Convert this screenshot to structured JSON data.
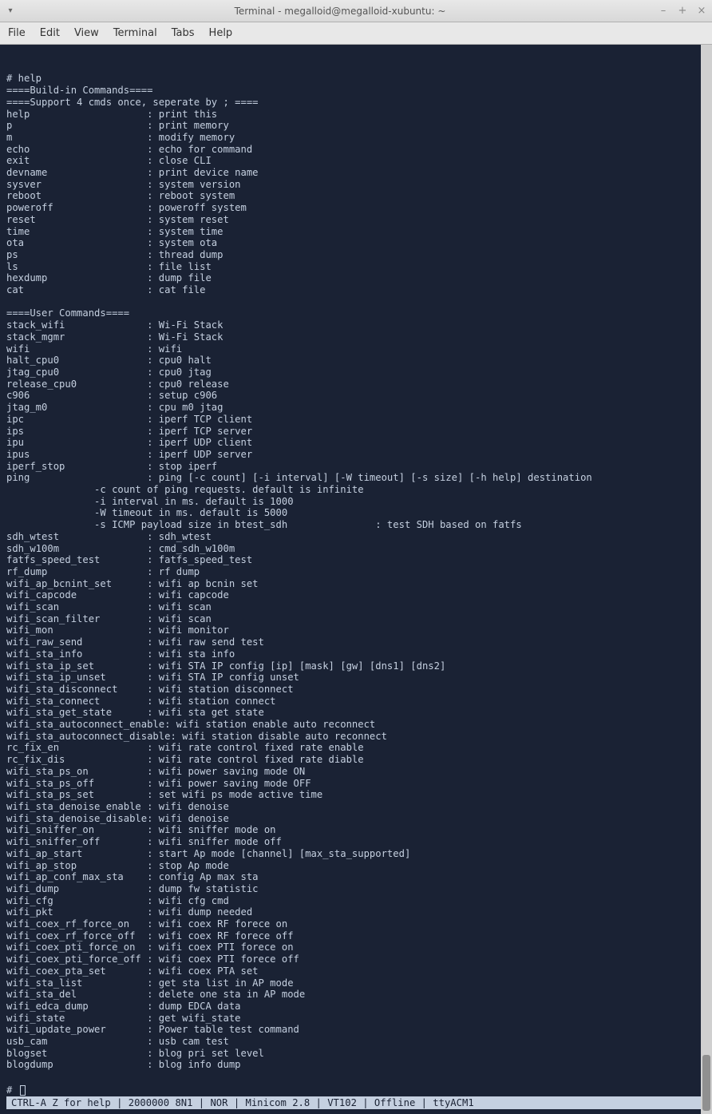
{
  "window": {
    "title": "Terminal - megalloid@megalloid-xubuntu: ~"
  },
  "menu": {
    "items": [
      "File",
      "Edit",
      "View",
      "Terminal",
      "Tabs",
      "Help"
    ]
  },
  "terminal": {
    "prompt1": "# help",
    "section_builtin": "====Build-in Commands====",
    "section_support": "====Support 4 cmds once, seperate by ; ====",
    "builtin_cmds": [
      {
        "cmd": "help",
        "desc": "print this"
      },
      {
        "cmd": "p",
        "desc": "print memory"
      },
      {
        "cmd": "m",
        "desc": "modify memory"
      },
      {
        "cmd": "echo",
        "desc": "echo for command"
      },
      {
        "cmd": "exit",
        "desc": "close CLI"
      },
      {
        "cmd": "devname",
        "desc": "print device name"
      },
      {
        "cmd": "sysver",
        "desc": "system version"
      },
      {
        "cmd": "reboot",
        "desc": "reboot system"
      },
      {
        "cmd": "poweroff",
        "desc": "poweroff system"
      },
      {
        "cmd": "reset",
        "desc": "system reset"
      },
      {
        "cmd": "time",
        "desc": "system time"
      },
      {
        "cmd": "ota",
        "desc": "system ota"
      },
      {
        "cmd": "ps",
        "desc": "thread dump"
      },
      {
        "cmd": "ls",
        "desc": "file list"
      },
      {
        "cmd": "hexdump",
        "desc": "dump file"
      },
      {
        "cmd": "cat",
        "desc": "cat file"
      }
    ],
    "section_user": "====User Commands====",
    "user_cmds_a": [
      {
        "cmd": "stack_wifi",
        "desc": "Wi-Fi Stack"
      },
      {
        "cmd": "stack_mgmr",
        "desc": "Wi-Fi Stack"
      },
      {
        "cmd": "wifi",
        "desc": "wifi"
      },
      {
        "cmd": "halt_cpu0",
        "desc": "cpu0 halt"
      },
      {
        "cmd": "jtag_cpu0",
        "desc": "cpu0 jtag"
      },
      {
        "cmd": "release_cpu0",
        "desc": "cpu0 release"
      },
      {
        "cmd": "c906",
        "desc": "setup c906"
      },
      {
        "cmd": "jtag_m0",
        "desc": "cpu m0 jtag"
      },
      {
        "cmd": "ipc",
        "desc": "iperf TCP client"
      },
      {
        "cmd": "ips",
        "desc": "iperf TCP server"
      },
      {
        "cmd": "ipu",
        "desc": "iperf UDP client"
      },
      {
        "cmd": "ipus",
        "desc": "iperf UDP server"
      },
      {
        "cmd": "iperf_stop",
        "desc": "stop iperf"
      },
      {
        "cmd": "ping",
        "desc": "ping [-c count] [-i interval] [-W timeout] [-s size] [-h help] destination"
      }
    ],
    "ping_opts": [
      "               -c count of ping requests. default is infinite",
      "               -i interval in ms. default is 1000",
      "               -W timeout in ms. default is 5000",
      "               -s ICMP payload size in btest_sdh               : test SDH based on fatfs"
    ],
    "user_cmds_b": [
      {
        "cmd": "sdh_wtest",
        "desc": "sdh_wtest"
      },
      {
        "cmd": "sdh_w100m",
        "desc": "cmd_sdh_w100m"
      },
      {
        "cmd": "fatfs_speed_test",
        "desc": "fatfs_speed_test"
      },
      {
        "cmd": "rf_dump",
        "desc": "rf dump"
      },
      {
        "cmd": "wifi_ap_bcnint_set",
        "desc": "wifi ap bcnin set"
      },
      {
        "cmd": "wifi_capcode",
        "desc": "wifi capcode"
      },
      {
        "cmd": "wifi_scan",
        "desc": "wifi scan"
      },
      {
        "cmd": "wifi_scan_filter",
        "desc": "wifi scan"
      },
      {
        "cmd": "wifi_mon",
        "desc": "wifi monitor"
      },
      {
        "cmd": "wifi_raw_send",
        "desc": "wifi raw send test"
      },
      {
        "cmd": "wifi_sta_info",
        "desc": "wifi sta info"
      },
      {
        "cmd": "wifi_sta_ip_set",
        "desc": "wifi STA IP config [ip] [mask] [gw] [dns1] [dns2]"
      },
      {
        "cmd": "wifi_sta_ip_unset",
        "desc": "wifi STA IP config unset"
      },
      {
        "cmd": "wifi_sta_disconnect",
        "desc": "wifi station disconnect"
      },
      {
        "cmd": "wifi_sta_connect",
        "desc": "wifi station connect"
      },
      {
        "cmd": "wifi_sta_get_state",
        "desc": "wifi sta get state"
      }
    ],
    "long_cmds": [
      "wifi_sta_autoconnect_enable: wifi station enable auto reconnect",
      "wifi_sta_autoconnect_disable: wifi station disable auto reconnect"
    ],
    "user_cmds_c": [
      {
        "cmd": "rc_fix_en",
        "desc": "wifi rate control fixed rate enable"
      },
      {
        "cmd": "rc_fix_dis",
        "desc": "wifi rate control fixed rate diable"
      },
      {
        "cmd": "wifi_sta_ps_on",
        "desc": "wifi power saving mode ON"
      },
      {
        "cmd": "wifi_sta_ps_off",
        "desc": "wifi power saving mode OFF"
      },
      {
        "cmd": "wifi_sta_ps_set",
        "desc": "set wifi ps mode active time"
      },
      {
        "cmd": "wifi_sta_denoise_enable",
        "desc": "wifi denoise"
      },
      {
        "cmd": "wifi_sta_denoise_disable",
        "desc": "wifi denoise"
      },
      {
        "cmd": "wifi_sniffer_on",
        "desc": "wifi sniffer mode on"
      },
      {
        "cmd": "wifi_sniffer_off",
        "desc": "wifi sniffer mode off"
      },
      {
        "cmd": "wifi_ap_start",
        "desc": "start Ap mode [channel] [max_sta_supported]"
      },
      {
        "cmd": "wifi_ap_stop",
        "desc": "stop Ap mode"
      },
      {
        "cmd": "wifi_ap_conf_max_sta",
        "desc": "config Ap max sta"
      },
      {
        "cmd": "wifi_dump",
        "desc": "dump fw statistic"
      },
      {
        "cmd": "wifi_cfg",
        "desc": "wifi cfg cmd"
      },
      {
        "cmd": "wifi_pkt",
        "desc": "wifi dump needed"
      },
      {
        "cmd": "wifi_coex_rf_force_on",
        "desc": "wifi coex RF forece on"
      },
      {
        "cmd": "wifi_coex_rf_force_off",
        "desc": "wifi coex RF forece off"
      },
      {
        "cmd": "wifi_coex_pti_force_on",
        "desc": "wifi coex PTI forece on"
      },
      {
        "cmd": "wifi_coex_pti_force_off",
        "desc": "wifi coex PTI forece off"
      },
      {
        "cmd": "wifi_coex_pta_set",
        "desc": "wifi coex PTA set"
      },
      {
        "cmd": "wifi_sta_list",
        "desc": "get sta list in AP mode"
      },
      {
        "cmd": "wifi_sta_del",
        "desc": "delete one sta in AP mode"
      },
      {
        "cmd": "wifi_edca_dump",
        "desc": "dump EDCA data"
      },
      {
        "cmd": "wifi_state",
        "desc": "get wifi_state"
      },
      {
        "cmd": "wifi_update_power",
        "desc": "Power table test command"
      },
      {
        "cmd": "usb_cam",
        "desc": "usb cam test"
      },
      {
        "cmd": "blogset",
        "desc": "blog pri set level"
      },
      {
        "cmd": "blogdump",
        "desc": "blog info dump"
      }
    ],
    "prompt2": "# "
  },
  "statusbar": {
    "text": "CTRL-A Z for help | 2000000 8N1 | NOR | Minicom 2.8 | VT102 | Offline | ttyACM1"
  }
}
